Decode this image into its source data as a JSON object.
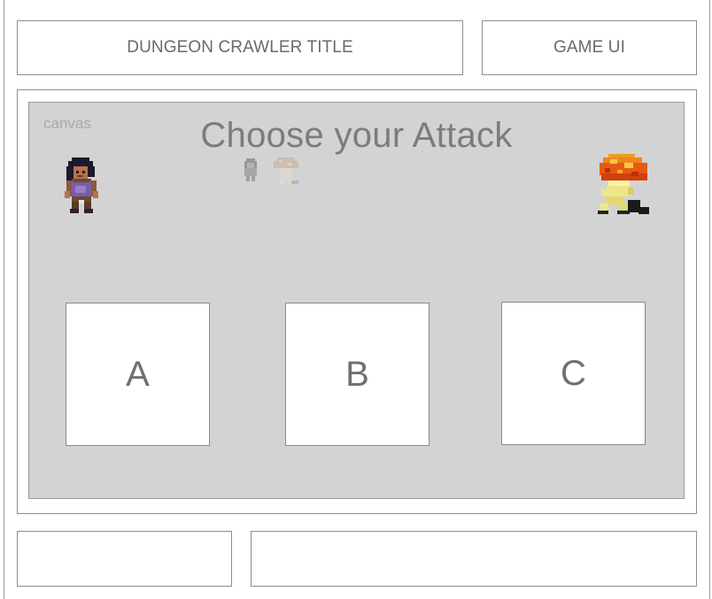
{
  "header": {
    "title": "DUNGEON CRAWLER TITLE",
    "game_ui": "GAME UI"
  },
  "canvas": {
    "tag": "canvas",
    "prompt": "Choose your Attack",
    "background_color": "#d3d3d3"
  },
  "sprites": {
    "player": "hero-sprite-icon",
    "enemy": "mushroom-monster-sprite-icon",
    "mini_player": "faded-hero-sprite-icon",
    "mini_enemy": "faded-mushroom-sprite-icon"
  },
  "attacks": [
    {
      "label": "A"
    },
    {
      "label": "B"
    },
    {
      "label": "C"
    }
  ],
  "footer": {
    "left": "",
    "right": ""
  }
}
